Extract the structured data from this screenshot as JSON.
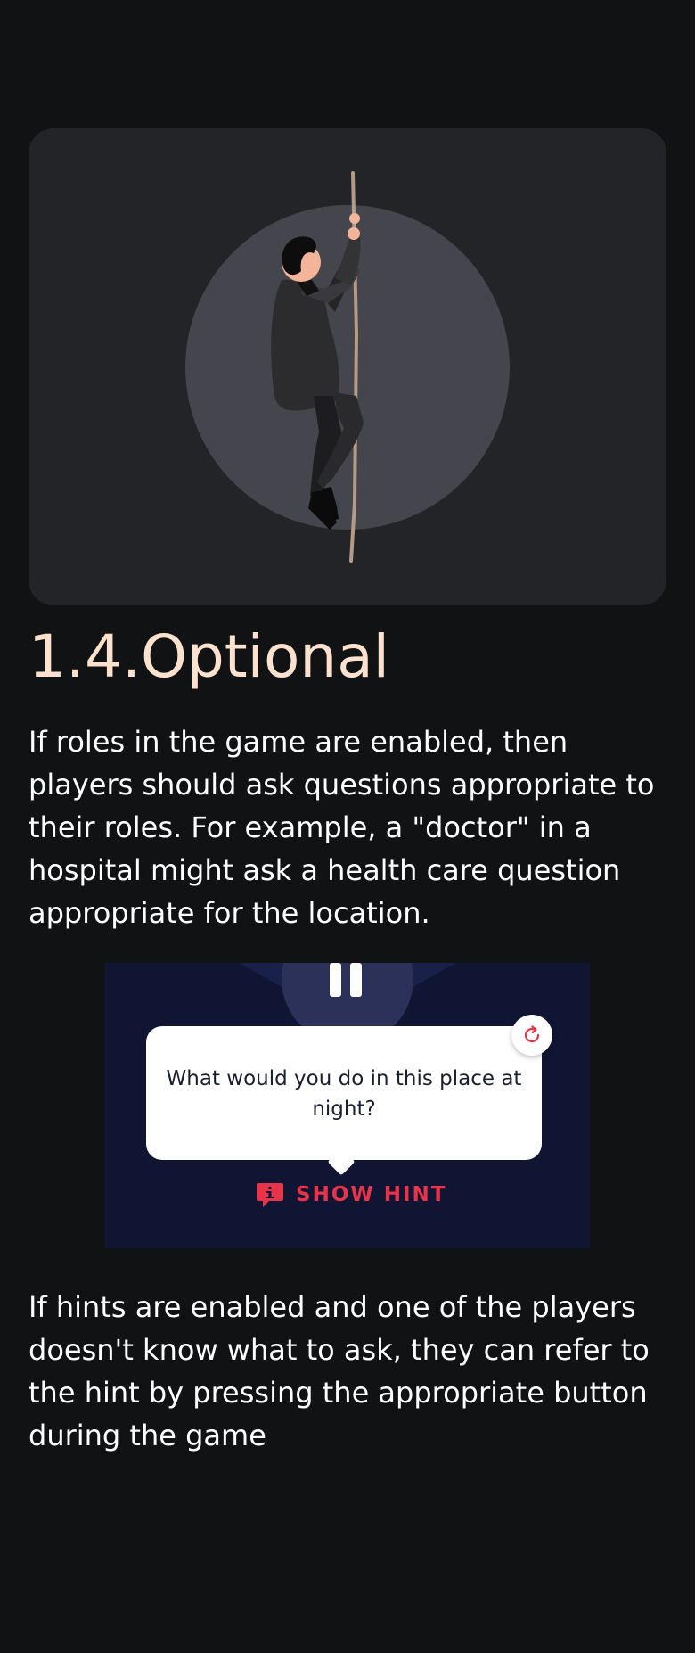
{
  "hero": {
    "illustration": "man-climbing-rope",
    "card_color": "#232427",
    "spotlight_color": "#45464d"
  },
  "section": {
    "title": "1.4.Optional",
    "title_color": "#fde1cf"
  },
  "paragraphs": {
    "roles": "If roles in the game are enabled, then players should ask questions appropriate to their roles. For example, a \"doctor\" in a hospital might ask a health care question appropriate for the location.",
    "hints": "If hints are enabled and one of the players doesn't know what to ask, they can refer to the hint by pressing the appropriate button during the game"
  },
  "game_preview": {
    "background": "#0f1533",
    "pause_icon": "pause-icon",
    "question": "What would you do in this place at night?",
    "refresh_icon": "refresh-icon",
    "hint_icon": "info-bubble-icon",
    "hint_label": "SHOW HINT",
    "accent": "#e8344a"
  }
}
